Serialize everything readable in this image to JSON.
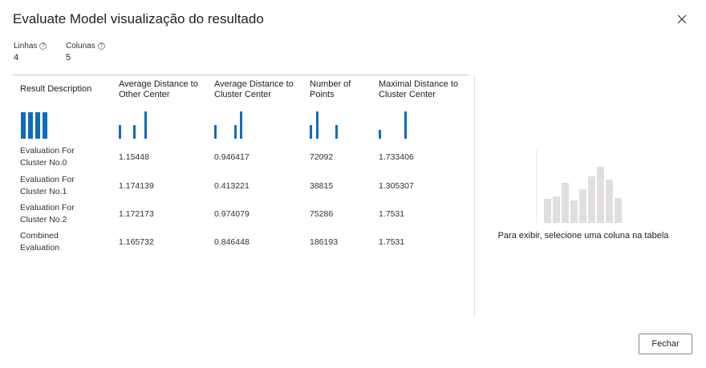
{
  "dialog": {
    "title": "Evaluate Model visualização do resultado",
    "close_label": "Fechar"
  },
  "stats": {
    "rows_label": "Linhas",
    "rows_value": "4",
    "columns_label": "Colunas",
    "columns_value": "5",
    "info_glyph": "?"
  },
  "table": {
    "columns": [
      "Result Description",
      "Average Distance to Other Center",
      "Average Distance to Cluster Center",
      "Number of Points",
      "Maximal Distance to Cluster Center"
    ],
    "rows": [
      [
        "Evaluation For Cluster No.0",
        "1.15448",
        "0.946417",
        "72092",
        "1.733406"
      ],
      [
        "Evaluation For Cluster No.1",
        "1.174139",
        "0.413221",
        "38815",
        "1.305307"
      ],
      [
        "Evaluation For Cluster No.2",
        "1.172173",
        "0.974079",
        "75286",
        "1.7531"
      ],
      [
        "Combined Evaluation",
        "1.165732",
        "0.846448",
        "186193",
        "1.7531"
      ]
    ]
  },
  "side_panel": {
    "hint": "Para exibir, selecione uma coluna na tabela"
  },
  "colors": {
    "accent": "#0f6cbd",
    "placeholder_bars": "#e1dfdd"
  },
  "icons": [
    "close-icon",
    "info-icon"
  ]
}
